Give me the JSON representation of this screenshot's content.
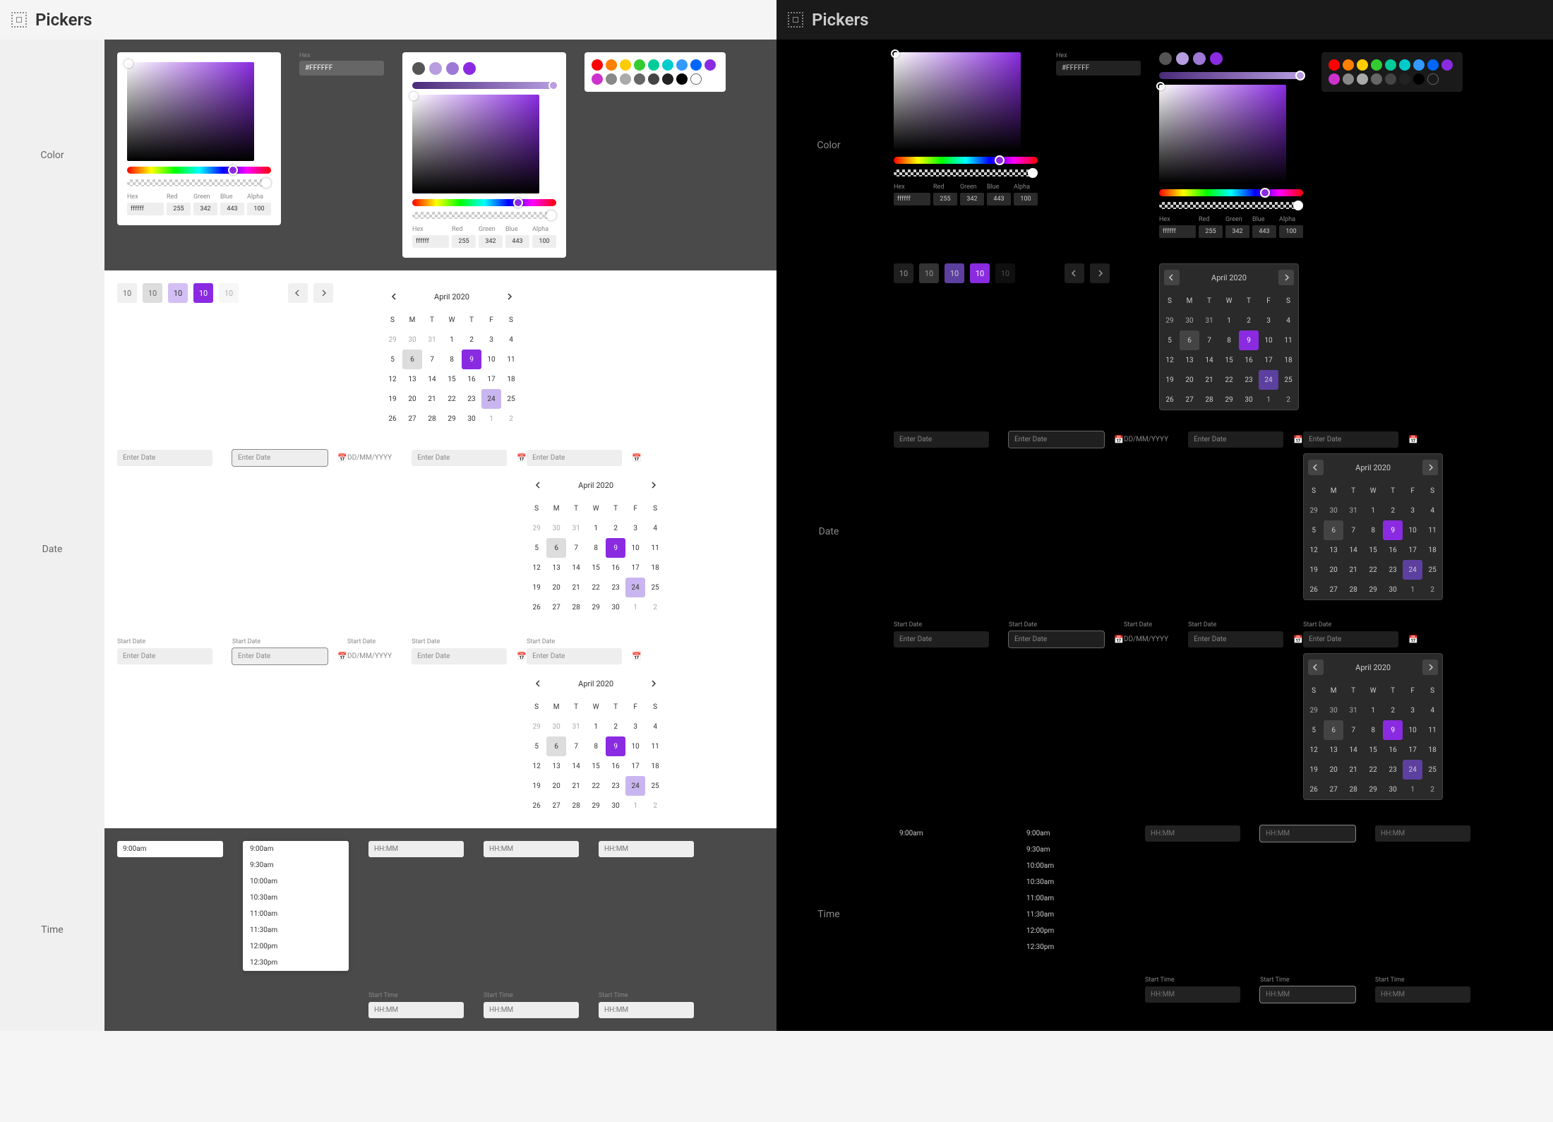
{
  "title": "Pickers",
  "sections": {
    "color": "Color",
    "date": "Date",
    "time": "Time"
  },
  "color": {
    "hexLabel": "Hex",
    "hexValue": "#FFFFFF",
    "hexValueLower": "ffffff",
    "labels": {
      "hex": "Hex",
      "red": "Red",
      "green": "Green",
      "blue": "Blue",
      "alpha": "Alpha"
    },
    "values": {
      "red": "255",
      "green": "342",
      "blue": "443",
      "alpha": "100"
    },
    "selectDots": [
      "#555",
      "#b89de0",
      "#9d78d6",
      "#8a2be2"
    ],
    "swatches": [
      "#ff0000",
      "#ff7f00",
      "#ffcc00",
      "#33cc33",
      "#00cc99",
      "#00cccc",
      "#3399ff",
      "#0066ff",
      "#8a2be2",
      "#cc33cc",
      "#888888",
      "#aaaaaa",
      "#666666",
      "#444444",
      "#222222",
      "#000000"
    ]
  },
  "date": {
    "chips": [
      "10",
      "10",
      "10",
      "10",
      "10"
    ],
    "cal": {
      "title": "April 2020",
      "days": [
        "S",
        "M",
        "T",
        "W",
        "T",
        "F",
        "S"
      ],
      "rows": [
        [
          "29",
          "30",
          "31",
          "1",
          "2",
          "3",
          "4"
        ],
        [
          "5",
          "6",
          "7",
          "8",
          "9",
          "10",
          "11"
        ],
        [
          "12",
          "13",
          "14",
          "15",
          "16",
          "17",
          "18"
        ],
        [
          "19",
          "20",
          "21",
          "22",
          "23",
          "24",
          "25"
        ],
        [
          "26",
          "27",
          "28",
          "29",
          "30",
          "1",
          "2"
        ]
      ],
      "prevCells": [
        0,
        1,
        2
      ],
      "lastPrev": [
        5,
        6
      ],
      "hoverDay": "6",
      "today": "9",
      "rangeEnd": "24"
    },
    "placeholder": "Enter Date",
    "ghost": "DD/MM/YYYY",
    "startLabel": "Start Date"
  },
  "time": {
    "value": "9:00am",
    "placeholder": "HH:MM",
    "startLabel": "Start Time",
    "options": [
      "9:00am",
      "9:30am",
      "10:00am",
      "10:30am",
      "11:00am",
      "11:30am",
      "12:00pm",
      "12:30pm"
    ]
  }
}
